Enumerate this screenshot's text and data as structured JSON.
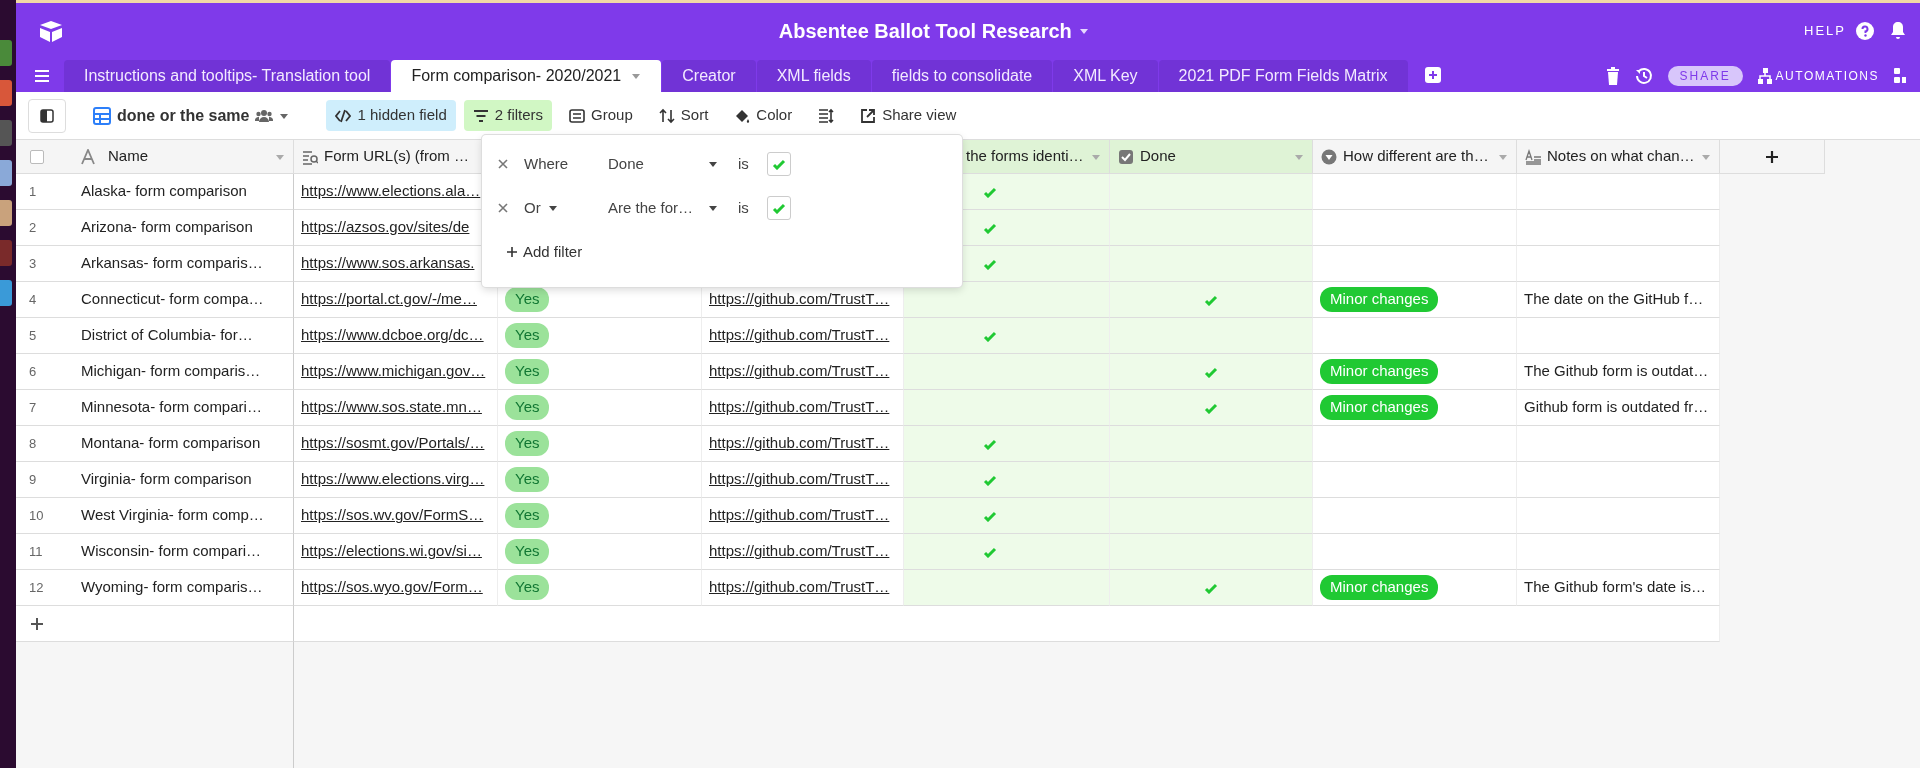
{
  "base": {
    "title": "Absentee Ballot Tool Research",
    "help": "HELP"
  },
  "tabs": [
    {
      "label": "Instructions and tooltips- Translation tool",
      "selected": false
    },
    {
      "label": "Form comparison- 2020/2021",
      "selected": true
    },
    {
      "label": "Creator",
      "selected": false
    },
    {
      "label": "XML fields",
      "selected": false
    },
    {
      "label": "fields to consolidate",
      "selected": false
    },
    {
      "label": "XML Key",
      "selected": false
    },
    {
      "label": "2021 PDF Form Fields Matrix",
      "selected": false
    }
  ],
  "tab_actions": {
    "share": "SHARE",
    "automations": "AUTOMATIONS"
  },
  "toolbar": {
    "view_name": "done or the same",
    "buttons": [
      {
        "kind": "hidden",
        "label": "1 hidden field",
        "active": true
      },
      {
        "kind": "filter",
        "label": "2 filters",
        "active": true
      },
      {
        "kind": "group",
        "label": "Group"
      },
      {
        "kind": "sort",
        "label": "Sort"
      },
      {
        "kind": "color",
        "label": "Color"
      },
      {
        "kind": "height"
      },
      {
        "kind": "share",
        "label": "Share view"
      }
    ]
  },
  "select_all": {
    "checked": false
  },
  "columns": [
    {
      "kind": "text",
      "label": "Name",
      "filtered": false
    },
    {
      "kind": "lookup",
      "label": "Form URL(s) (from …",
      "filtered": false
    },
    {
      "kind": "hidden"
    },
    {
      "kind": "hidden"
    },
    {
      "kind": "check",
      "label": "the forms identi…",
      "filtered": true
    },
    {
      "kind": "check",
      "label": "Done",
      "filtered": true
    },
    {
      "kind": "select",
      "label": "How different are th…",
      "filtered": false
    },
    {
      "kind": "longtext",
      "label": "Notes on what chan…",
      "filtered": false
    }
  ],
  "rows": [
    {
      "number": "1",
      "name": "Alaska- form comparison",
      "form_url": "https://www.elections.ala…",
      "identical": true,
      "done": false
    },
    {
      "number": "2",
      "name": "Arizona- form comparison",
      "form_url": "https://azsos.gov/sites/de",
      "identical": true,
      "done": false
    },
    {
      "number": "3",
      "name": "Arkansas- form comparis…",
      "form_url": "https://www.sos.arkansas.",
      "identical": true,
      "done": false
    },
    {
      "number": "4",
      "name": "Connecticut- form compa…",
      "form_url": "https://portal.ct.gov/-/me…",
      "column_3": "Yes",
      "column_4": "https://github.com/TrustT…",
      "identical": false,
      "done": true,
      "difference": "Minor changes",
      "notes": "The date on the GitHub f…"
    },
    {
      "number": "5",
      "name": "District of Columbia- for…",
      "form_url": "https://www.dcboe.org/dc…",
      "column_3": "Yes",
      "column_4": "https://github.com/TrustT…",
      "identical": true,
      "done": false
    },
    {
      "number": "6",
      "name": "Michigan- form comparis…",
      "form_url": "https://www.michigan.gov…",
      "column_3": "Yes",
      "column_4": "https://github.com/TrustT…",
      "identical": false,
      "done": true,
      "difference": "Minor changes",
      "notes": "The Github form is outdat…"
    },
    {
      "number": "7",
      "name": "Minnesota- form compari…",
      "form_url": "https://www.sos.state.mn…",
      "column_3": "Yes",
      "column_4": "https://github.com/TrustT…",
      "identical": false,
      "done": true,
      "difference": "Minor changes",
      "notes": "Github form is outdated fr…"
    },
    {
      "number": "8",
      "name": "Montana- form comparison",
      "form_url": "https://sosmt.gov/Portals/…",
      "column_3": "Yes",
      "column_4": "https://github.com/TrustT…",
      "identical": true,
      "done": false
    },
    {
      "number": "9",
      "name": "Virginia- form comparison",
      "form_url": "https://www.elections.virg…",
      "column_3": "Yes",
      "column_4": "https://github.com/TrustT…",
      "identical": true,
      "done": false
    },
    {
      "number": "10",
      "name": "West Virginia- form comp…",
      "form_url": "https://sos.wv.gov/FormS…",
      "column_3": "Yes",
      "column_4": "https://github.com/TrustT…",
      "identical": true,
      "done": false
    },
    {
      "number": "11",
      "name": "Wisconsin- form compari…",
      "form_url": "https://elections.wi.gov/si…",
      "column_3": "Yes",
      "column_4": "https://github.com/TrustT…",
      "identical": true,
      "done": false
    },
    {
      "number": "12",
      "name": "Wyoming- form comparis…",
      "form_url": "https://sos.wyo.gov/Form…",
      "column_3": "Yes",
      "column_4": "https://github.com/TrustT…",
      "identical": false,
      "done": true,
      "difference": "Minor changes",
      "notes": "The Github form's date is…"
    }
  ],
  "filter_popover": {
    "filters": [
      {
        "conjunction": "Where",
        "has_dropdown": false,
        "field": "Done",
        "operator": "is",
        "checked": true
      },
      {
        "conjunction": "Or",
        "has_dropdown": true,
        "field": "Are the for…",
        "operator": "is",
        "checked": true
      }
    ],
    "add": "Add filter"
  }
}
